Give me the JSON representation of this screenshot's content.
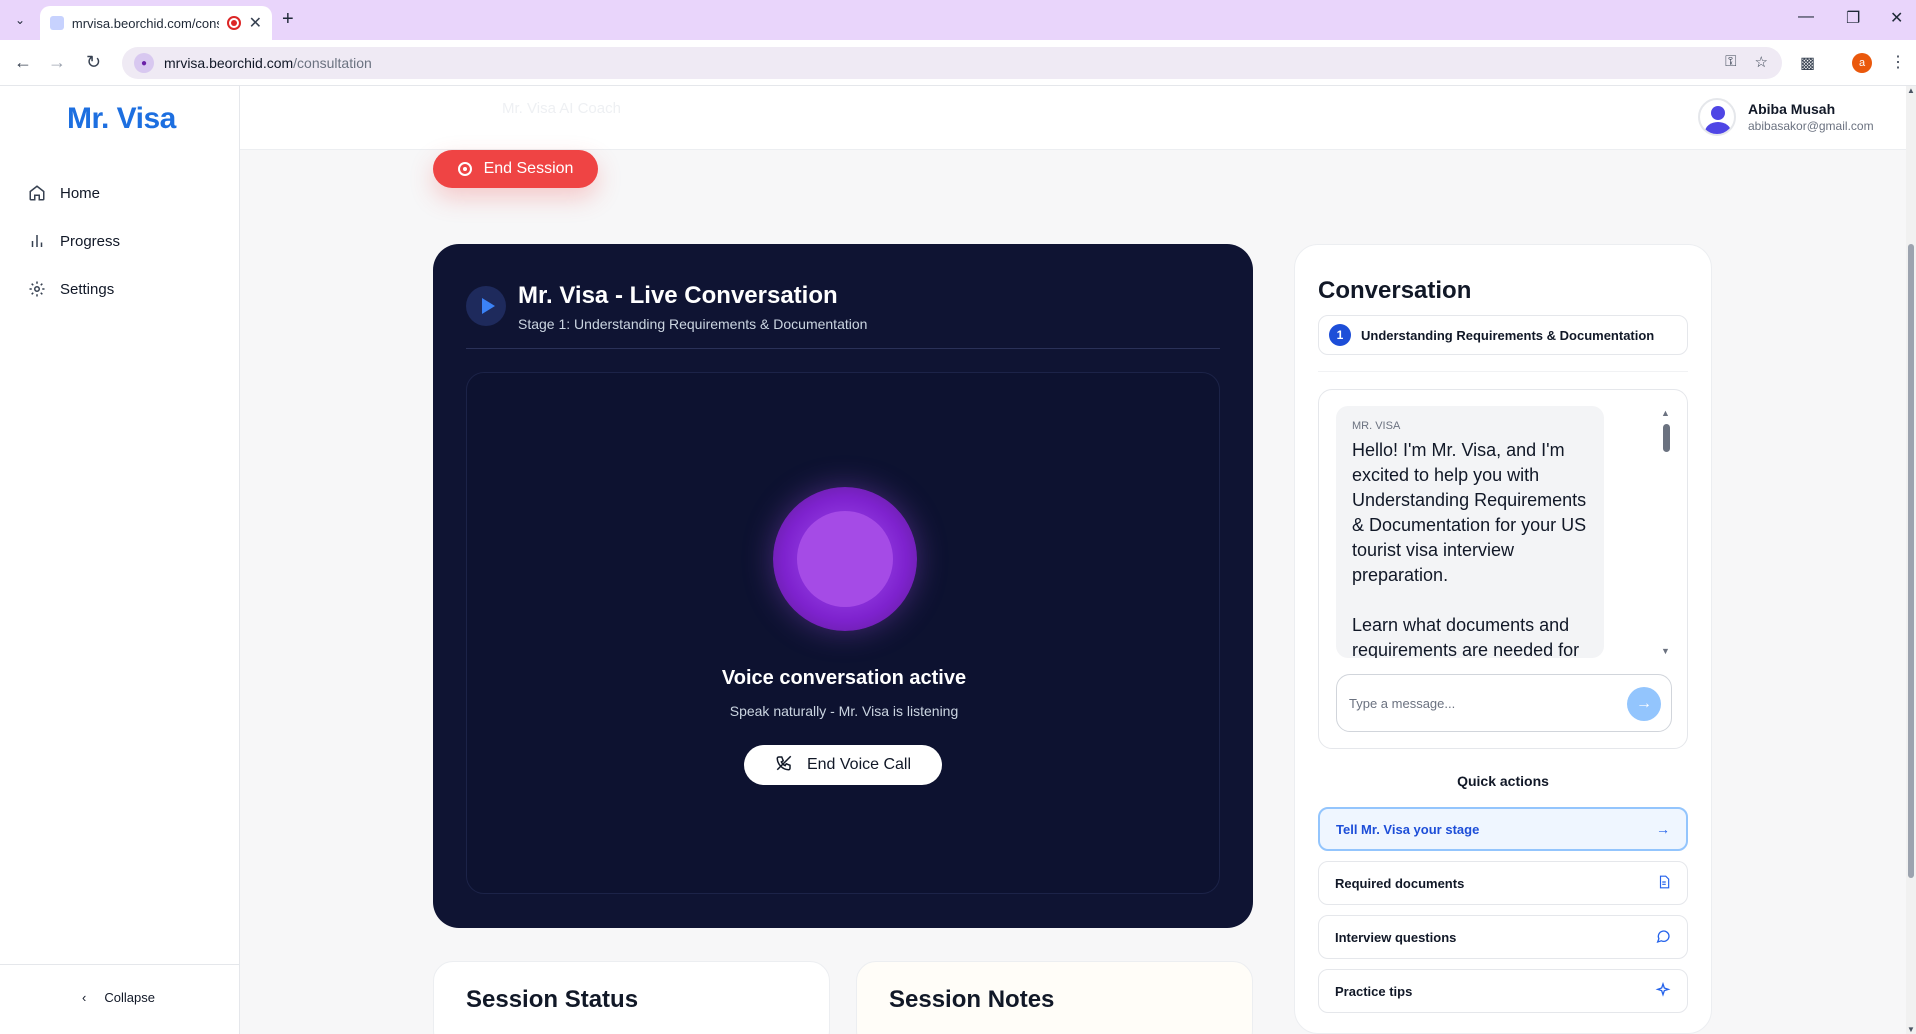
{
  "browser": {
    "tab_title": "mrvisa.beorchid.com/consu",
    "new_tab_symbol": "+",
    "url_host": "mrvisa.beorchid.com",
    "url_path": "/consultation",
    "profile_initial": "a"
  },
  "app": {
    "logo": "Mr. Visa",
    "nav": [
      {
        "label": "Home",
        "icon": "home-icon"
      },
      {
        "label": "Progress",
        "icon": "bar-chart-icon"
      },
      {
        "label": "Settings",
        "icon": "gear-icon"
      }
    ],
    "collapse_label": "Collapse",
    "header_ghost": "Mr. Visa AI Coach"
  },
  "user": {
    "name": "Abiba Musah",
    "email": "abibasakor@gmail.com"
  },
  "session": {
    "end_session_label": "End Session"
  },
  "live": {
    "title": "Mr. Visa - Live Conversation",
    "subtitle": "Stage 1: Understanding Requirements & Documentation",
    "status": "Voice conversation active",
    "hint": "Speak naturally - Mr. Visa is listening",
    "end_voice_label": "End Voice Call"
  },
  "conversation": {
    "title": "Conversation",
    "stage_number": "1",
    "stage_label": "Understanding Requirements & Documentation",
    "message_sender": "MR. VISA",
    "message_text": "Hello! I'm Mr. Visa, and I'm excited to help you with Understanding Requirements & Documentation for your US tourist visa interview preparation.\n\nLearn what documents and requirements are needed for",
    "input_placeholder": "Type a message...",
    "quick_actions_title": "Quick actions",
    "quick_actions": [
      {
        "label": "Tell Mr. Visa your stage",
        "icon": "arrow-right-icon",
        "active": true
      },
      {
        "label": "Required documents",
        "icon": "document-icon",
        "active": false
      },
      {
        "label": "Interview questions",
        "icon": "chat-bubble-icon",
        "active": false
      },
      {
        "label": "Practice tips",
        "icon": "sparkle-icon",
        "active": false
      }
    ]
  },
  "bottom_cards": {
    "status_title": "Session Status",
    "notes_title": "Session Notes"
  },
  "colors": {
    "brand": "#1d6fe0",
    "danger": "#ef4444",
    "live_bg": "#0f1433",
    "orb": "#a855f7"
  }
}
